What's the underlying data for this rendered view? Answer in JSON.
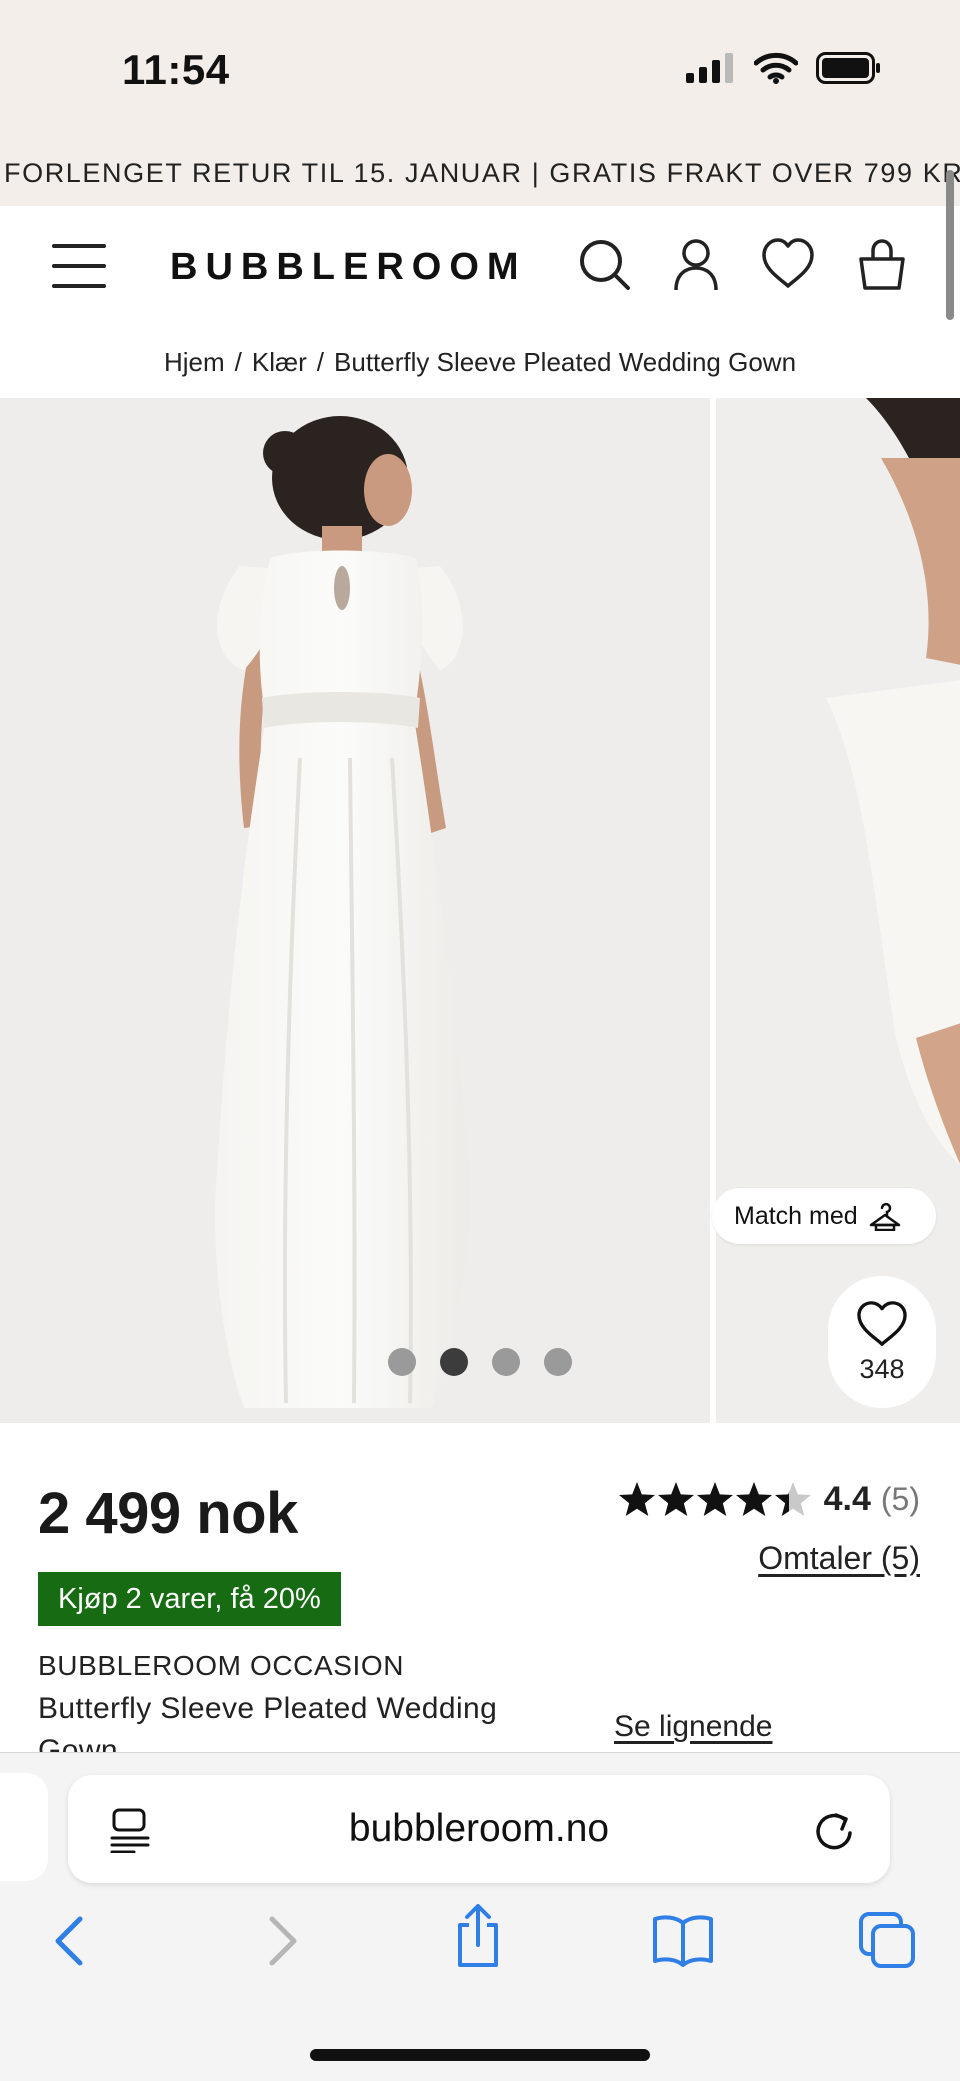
{
  "status_bar": {
    "time": "11:54",
    "icons": [
      "signal-icon",
      "wifi-icon",
      "battery-icon"
    ]
  },
  "promo_banner": {
    "text": "FORLENGET RETUR TIL 15. JANUAR | GRATIS FRAKT OVER 799 KR*"
  },
  "header": {
    "logo": "BUBBLEROOM",
    "icons": [
      "menu-icon",
      "search-icon",
      "account-icon",
      "heart-icon",
      "bag-icon"
    ]
  },
  "breadcrumb": {
    "items": [
      "Hjem",
      "Klær",
      "Butterfly Sleeve Pleated Wedding Gown"
    ],
    "separator": "/"
  },
  "gallery": {
    "slide_count": 4,
    "active_slide": 2,
    "match_label": "Match med",
    "favorites_count": "348"
  },
  "product": {
    "price": "2 499 nok",
    "promo_badge": "Kjøp 2 varer, få 20%",
    "brand": "BUBBLEROOM OCCASION",
    "name_line1": "Butterfly Sleeve Pleated Wedding",
    "name_line2": "Gown",
    "rating_value": "4.4",
    "rating_count": "(5)",
    "rating_stars": 4.4,
    "reviews_link": "Omtaler (5)",
    "similar_link": "Se lignende"
  },
  "browser": {
    "url": "bubbleroom.no",
    "toolbar_icons": [
      "back-icon",
      "forward-icon",
      "share-icon",
      "bookmarks-icon",
      "tabs-icon"
    ]
  },
  "colors": {
    "banner_bg": "#f3eee9",
    "promo_badge_bg": "#176b12",
    "safari_blue": "#2f7fe6"
  }
}
